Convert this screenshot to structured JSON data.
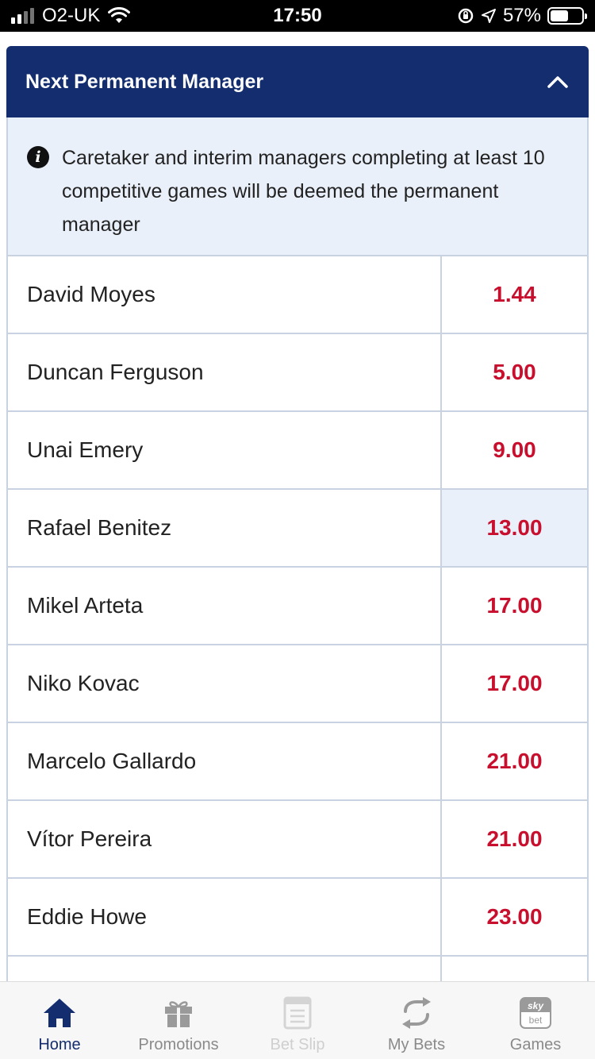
{
  "status_bar": {
    "carrier": "O2-UK",
    "time": "17:50",
    "battery": "57%",
    "battery_level": 0.57
  },
  "market": {
    "title": "Next Permanent Manager",
    "expanded": true,
    "info_text": "Caretaker and interim managers completing at least 10 competitive games will be deemed the permanent manager"
  },
  "runners": [
    {
      "name": "David Moyes",
      "odds": "1.44"
    },
    {
      "name": "Duncan Ferguson",
      "odds": "5.00"
    },
    {
      "name": "Unai Emery",
      "odds": "9.00"
    },
    {
      "name": "Rafael Benitez",
      "odds": "13.00"
    },
    {
      "name": "Mikel Arteta",
      "odds": "17.00"
    },
    {
      "name": "Niko Kovac",
      "odds": "17.00"
    },
    {
      "name": "Marcelo Gallardo",
      "odds": "21.00"
    },
    {
      "name": "Vítor Pereira",
      "odds": "21.00"
    },
    {
      "name": "Eddie Howe",
      "odds": "23.00"
    },
    {
      "name": "",
      "odds": ""
    }
  ],
  "bottom_nav": {
    "items": [
      {
        "label": "Home",
        "icon": "home-icon",
        "state": "active"
      },
      {
        "label": "Promotions",
        "icon": "gift-icon",
        "state": "normal"
      },
      {
        "label": "Bet Slip",
        "icon": "betslip-icon",
        "state": "disabled"
      },
      {
        "label": "My Bets",
        "icon": "refresh-icon",
        "state": "normal"
      },
      {
        "label": "Games",
        "icon": "skybet-icon",
        "state": "normal",
        "badge_top": "sky",
        "badge_bottom": "bet"
      }
    ]
  },
  "colors": {
    "header_bg": "#132d6e",
    "odds": "#c8102e",
    "info_bg": "#eaf0fa"
  }
}
